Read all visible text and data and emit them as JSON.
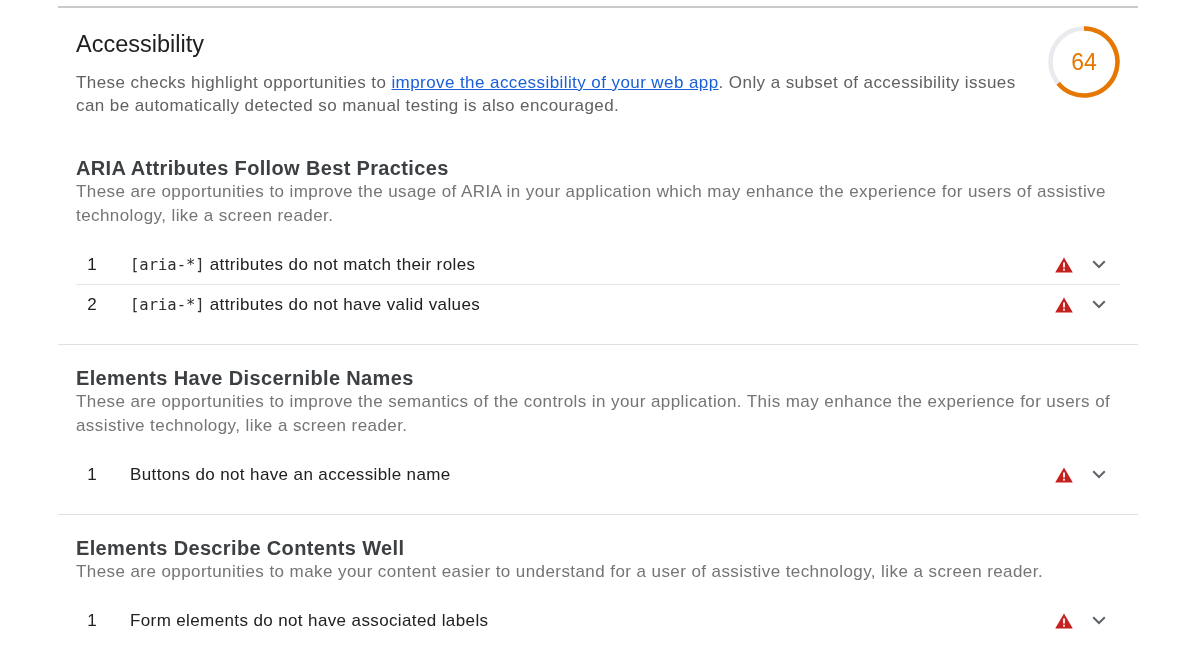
{
  "section": {
    "title": "Accessibility",
    "description": [
      {
        "kind": "text",
        "text": "These checks highlight opportunities to "
      },
      {
        "kind": "link",
        "text": "improve the accessibility of your web app"
      },
      {
        "kind": "text",
        "text": ". Only a subset of accessibility issues can be automatically detected so manual testing is also encouraged."
      }
    ],
    "score": {
      "value": "64"
    }
  },
  "groups": [
    {
      "title": "ARIA Attributes Follow Best Practices",
      "description": "These are opportunities to improve the usage of ARIA in your application which may enhance the experience for users of assistive technology, like a screen reader.",
      "audits": [
        {
          "number": "1",
          "code": "[aria-*]",
          "title": "attributes do not match their roles",
          "expanded": false
        },
        {
          "number": "2",
          "code": "[aria-*]",
          "title": "attributes do not have valid values",
          "expanded": false
        }
      ]
    },
    {
      "title": "Elements Have Discernible Names",
      "description": "These are opportunities to improve the semantics of the controls in your application. This may enhance the experience for users of assistive technology, like a screen reader.",
      "audits": [
        {
          "number": "1",
          "title": "Buttons do not have an accessible name",
          "expanded": false
        }
      ]
    },
    {
      "title": "Elements Describe Contents Well",
      "description": "These are opportunities to make your content easier to understand for a user of assistive technology, like a screen reader.",
      "audits": [
        {
          "number": "1",
          "title": "Form elements do not have associated labels",
          "expanded": false
        }
      ]
    }
  ]
}
